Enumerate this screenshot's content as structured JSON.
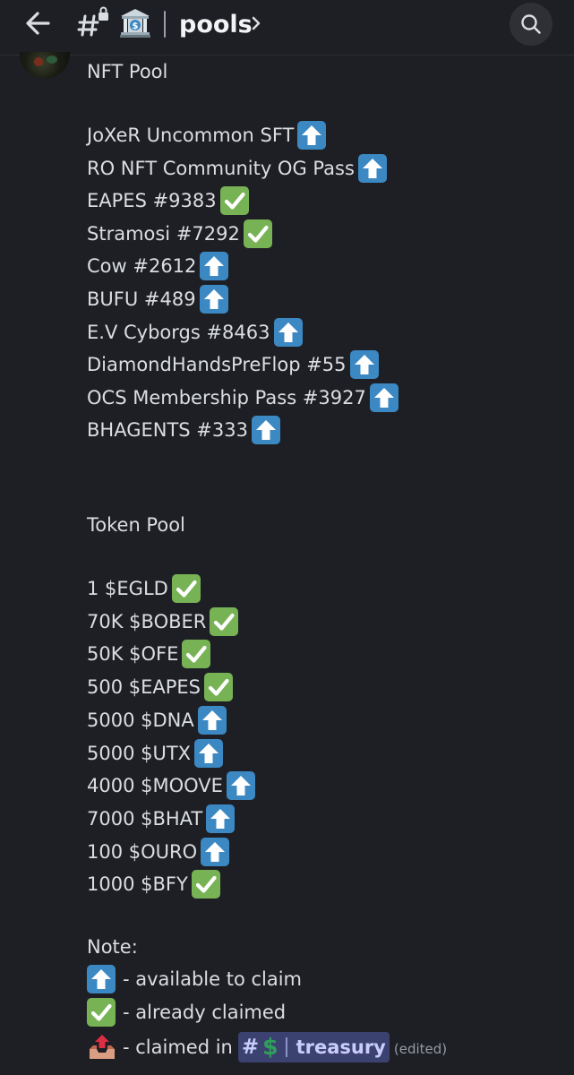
{
  "header": {
    "channel_name": "pools",
    "channel_emoji": "bank-icon"
  },
  "nft_section": {
    "title": "NFT Pool",
    "items": [
      {
        "label": "JoXeR Uncommon SFT",
        "status": "up"
      },
      {
        "label": "RO NFT Community OG Pass",
        "status": "up"
      },
      {
        "label": "EAPES #9383",
        "status": "check"
      },
      {
        "label": "Stramosi #7292",
        "status": "check"
      },
      {
        "label": "Cow #2612",
        "status": "up"
      },
      {
        "label": "BUFU #489",
        "status": "up"
      },
      {
        "label": "E.V Cyborgs #8463",
        "status": "up"
      },
      {
        "label": "DiamondHandsPreFlop #55",
        "status": "up"
      },
      {
        "label": "OCS Membership Pass #3927",
        "status": "up"
      },
      {
        "label": "BHAGENTS #333",
        "status": "up"
      }
    ]
  },
  "token_section": {
    "title": "Token Pool",
    "items": [
      {
        "label": "1 $EGLD",
        "status": "check"
      },
      {
        "label": "70K $BOBER",
        "status": "check"
      },
      {
        "label": "50K $OFE",
        "status": "check"
      },
      {
        "label": "500 $EAPES",
        "status": "check"
      },
      {
        "label": "5000 $DNA",
        "status": "up"
      },
      {
        "label": "5000 $UTX",
        "status": "up"
      },
      {
        "label": "4000 $MOOVE",
        "status": "up"
      },
      {
        "label": "7000 $BHAT",
        "status": "up"
      },
      {
        "label": "100 $OURO",
        "status": "up"
      },
      {
        "label": "1000 $BFY",
        "status": "check"
      }
    ]
  },
  "note": {
    "title": "Note:",
    "available": "- available to claim",
    "claimed": "- already claimed",
    "claimed_in": "- claimed in",
    "mention_channel": "treasury",
    "edited": "(edited)"
  },
  "colors": {
    "background": "#1e1f24",
    "text": "#dbdee1",
    "up_emoji": "#3b88c3",
    "check_emoji": "#77b255",
    "mention_bg": "#3c4270"
  }
}
